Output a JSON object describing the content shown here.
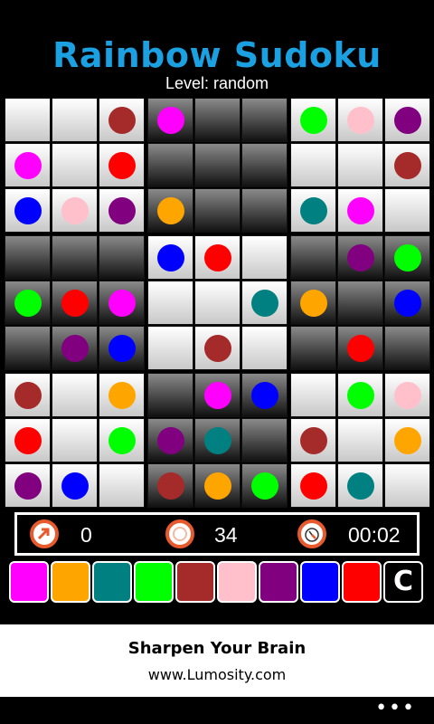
{
  "app": {
    "title": "Rainbow Sudoku",
    "level_text": "Level: random"
  },
  "colors": {
    "title": "#1ba1e2",
    "magenta": "#ff00ff",
    "orange": "#ffa500",
    "teal": "#008080",
    "green": "#00ff00",
    "brown": "#a52a2a",
    "pink": "#ffc0cb",
    "purple": "#800080",
    "blue": "#0000ff",
    "red": "#ff0000",
    "icon_ring": "#e85a2c"
  },
  "board": {
    "shading": [
      "LLLDDDLLL",
      "LLLDDDLLL",
      "LLLDDDLLL",
      "DDDLLLDDD",
      "DDDLLLDDD",
      "DDDLLLDDD",
      "LLLDDDLLL",
      "LLLDDDLLL",
      "LLLDDDLLL"
    ],
    "cells": [
      [
        "",
        "",
        "brown",
        "magenta",
        "",
        "",
        "green",
        "pink",
        "purple"
      ],
      [
        "magenta",
        "",
        "red",
        "",
        "",
        "",
        "",
        "",
        "brown"
      ],
      [
        "blue",
        "pink",
        "purple",
        "orange",
        "",
        "",
        "teal",
        "magenta",
        ""
      ],
      [
        "",
        "",
        "",
        "blue",
        "red",
        "",
        "",
        "purple",
        "green"
      ],
      [
        "green",
        "red",
        "magenta",
        "",
        "",
        "teal",
        "orange",
        "",
        "blue"
      ],
      [
        "",
        "purple",
        "blue",
        "",
        "brown",
        "",
        "",
        "red",
        ""
      ],
      [
        "brown",
        "",
        "orange",
        "",
        "magenta",
        "blue",
        "",
        "green",
        "pink"
      ],
      [
        "red",
        "",
        "green",
        "purple",
        "teal",
        "",
        "brown",
        "",
        "orange"
      ],
      [
        "purple",
        "blue",
        "",
        "brown",
        "orange",
        "green",
        "red",
        "teal",
        ""
      ]
    ]
  },
  "status": {
    "moves_icon": "moves-arrow-icon",
    "moves": "0",
    "remaining_icon": "ring-icon",
    "remaining": "34",
    "timer_icon": "stopwatch-icon",
    "time": "00:02"
  },
  "palette": {
    "swatches": [
      "magenta",
      "orange",
      "teal",
      "green",
      "brown",
      "pink",
      "purple",
      "blue",
      "red"
    ],
    "clear_label": "C"
  },
  "ad": {
    "title": "Sharpen Your Brain",
    "url": "www.Lumosity.com"
  },
  "appbar": {
    "more_label": "•••"
  }
}
